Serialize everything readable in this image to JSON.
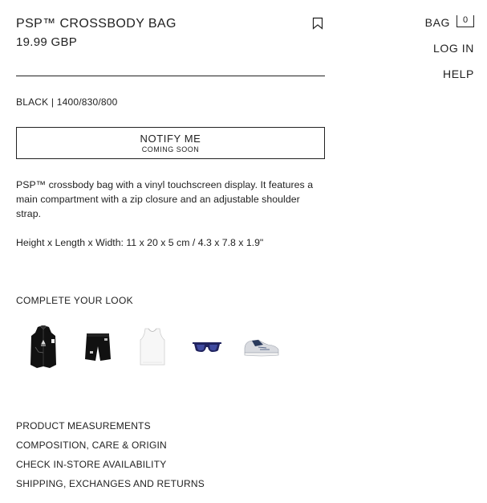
{
  "header": {
    "bag_label": "BAG",
    "bag_count": "0",
    "login_label": "LOG IN",
    "help_label": "HELP"
  },
  "product": {
    "title": "PSP™ CROSSBODY BAG",
    "price": "19.99 GBP",
    "variant": "BLACK | 1400/830/800",
    "bookmark_icon": "bookmark-icon",
    "notify_label": "NOTIFY ME",
    "notify_sublabel": "COMING SOON",
    "description": "PSP™ crossbody bag with a vinyl touchscreen display. It features a main compartment with a zip closure and an adjustable shoulder strap.",
    "dimensions": "Height x Length x Width: 11 x 20 x 5 cm / 4.3 x 7.8 x 1.9\""
  },
  "complete_look": {
    "title": "COMPLETE YOUR LOOK",
    "items": [
      "black-vest",
      "black-shorts",
      "white-tank-top",
      "sunglasses",
      "sneaker"
    ]
  },
  "info_links": [
    "PRODUCT MEASUREMENTS",
    "COMPOSITION, CARE & ORIGIN",
    "CHECK IN-STORE AVAILABILITY",
    "SHIPPING, EXCHANGES AND RETURNS"
  ]
}
